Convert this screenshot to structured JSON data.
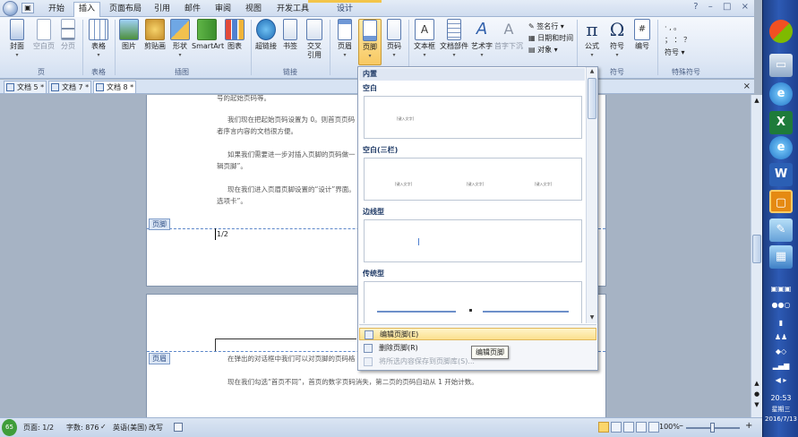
{
  "tabs": [
    "开始",
    "插入",
    "页面布局",
    "引用",
    "邮件",
    "审阅",
    "视图",
    "开发工具",
    "设计"
  ],
  "active_tab": "插入",
  "window_controls": [
    "?",
    "–",
    "□",
    "×"
  ],
  "ribbon": {
    "page_group": {
      "label": "页",
      "buttons": [
        "封面",
        "空白页",
        "分页"
      ]
    },
    "table_group": {
      "label": "表格",
      "buttons": [
        "表格"
      ]
    },
    "illustration_group": {
      "label": "插图",
      "buttons": [
        "图片",
        "剪贴画",
        "形状",
        "SmartArt",
        "图表"
      ]
    },
    "link_group": {
      "label": "链接",
      "buttons": [
        "超链接",
        "书签",
        "交叉\n引用"
      ]
    },
    "header_group": {
      "label": "页眉和页脚",
      "buttons": [
        "页眉",
        "页脚",
        "页码"
      ]
    },
    "text_group": {
      "label": "文本",
      "buttons": [
        "文本框",
        "文档部件",
        "艺术字",
        "首字下沉"
      ],
      "small": [
        "签名行 ▾",
        "日期和时间",
        "对象 ▾"
      ]
    },
    "symbol_group": {
      "label": "符号",
      "buttons": [
        "公式",
        "符号",
        "编号"
      ]
    },
    "special_group": {
      "label": "特殊符号",
      "small": [
        "·  ,  。",
        "；  ：  ？",
        "符号 ▾"
      ]
    }
  },
  "doc_tabs": [
    "文档 5 *",
    "文档 7 *",
    "文档 8 *"
  ],
  "doc_close": "×",
  "page1": {
    "lines": [
      "号的起始页码等。",
      "我们现在把起始页码设置为 0。则首页页码",
      "者序言内容的文档很方便。",
      "如果我们需要进一步对插入页脚的页码做一",
      "辑页脚”。",
      "现在我们进入页眉页脚设置的“设计”界面。",
      "选项卡”。"
    ],
    "footer_tag": "页脚",
    "footer_text": "1/2"
  },
  "page2": {
    "header_tag": "页眉",
    "lines": [
      "在弹出的对话框中我们可以对页脚的页码格",
      "现在我们勾选“首页不同”，首页的数字页码消失，第二页的页码自动从 1 开始计数。"
    ]
  },
  "gallery": {
    "section_title": "内置",
    "categories": [
      "空白",
      "空白(三栏)",
      "边线型",
      "传统型"
    ],
    "placeholder": "[键入文字]",
    "menu": [
      "编辑页脚(E)",
      "删除页脚(R)",
      "将所选内容保存到页脚库(S)..."
    ],
    "tooltip": "编辑页脚"
  },
  "status": {
    "page": "页面: 1/2",
    "words": "字数: 876",
    "lang": "英语(美国)",
    "mode": "改写",
    "zoom": "100%",
    "minus": "–",
    "plus": "+"
  },
  "taskbar": {
    "time": "20:53",
    "weekday": "星期三",
    "date": "2016/7/13"
  }
}
